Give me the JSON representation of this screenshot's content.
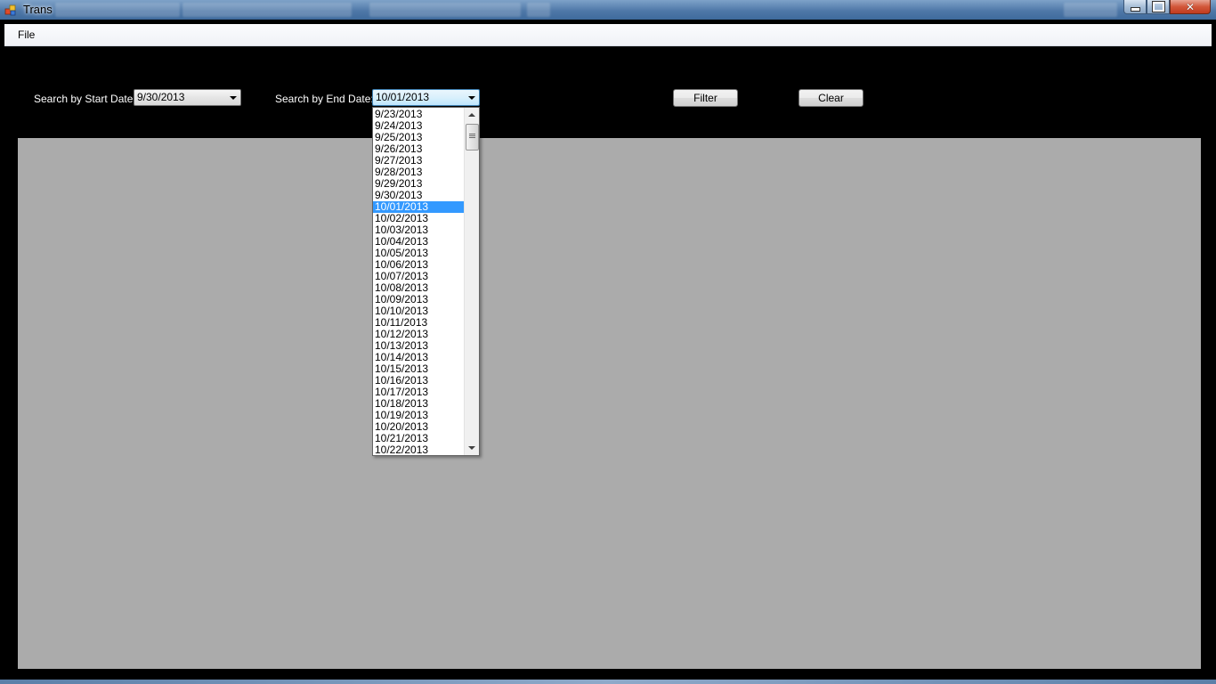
{
  "window": {
    "title": "Trans",
    "controls": {
      "minimize_icon": "minimize-icon",
      "maximize_icon": "maximize-icon",
      "close_icon": "close-icon"
    }
  },
  "menu": {
    "items": [
      "File"
    ]
  },
  "filters": {
    "start_label": "Search by Start Date:",
    "start_value": "9/30/2013",
    "end_label": "Search by End Date:",
    "end_value": "10/01/2013"
  },
  "buttons": {
    "filter": "Filter",
    "clear": "Clear"
  },
  "dropdown": {
    "selected": "10/01/2013",
    "options": [
      "9/23/2013",
      "9/24/2013",
      "9/25/2013",
      "9/26/2013",
      "9/27/2013",
      "9/28/2013",
      "9/29/2013",
      "9/30/2013",
      "10/01/2013",
      "10/02/2013",
      "10/03/2013",
      "10/04/2013",
      "10/05/2013",
      "10/06/2013",
      "10/07/2013",
      "10/08/2013",
      "10/09/2013",
      "10/10/2013",
      "10/11/2013",
      "10/12/2013",
      "10/13/2013",
      "10/14/2013",
      "10/15/2013",
      "10/16/2013",
      "10/17/2013",
      "10/18/2013",
      "10/19/2013",
      "10/20/2013",
      "10/21/2013",
      "10/22/2013"
    ]
  },
  "colors": {
    "form_background": "#000000",
    "grid_background": "#ababab",
    "selection": "#3399ff"
  }
}
